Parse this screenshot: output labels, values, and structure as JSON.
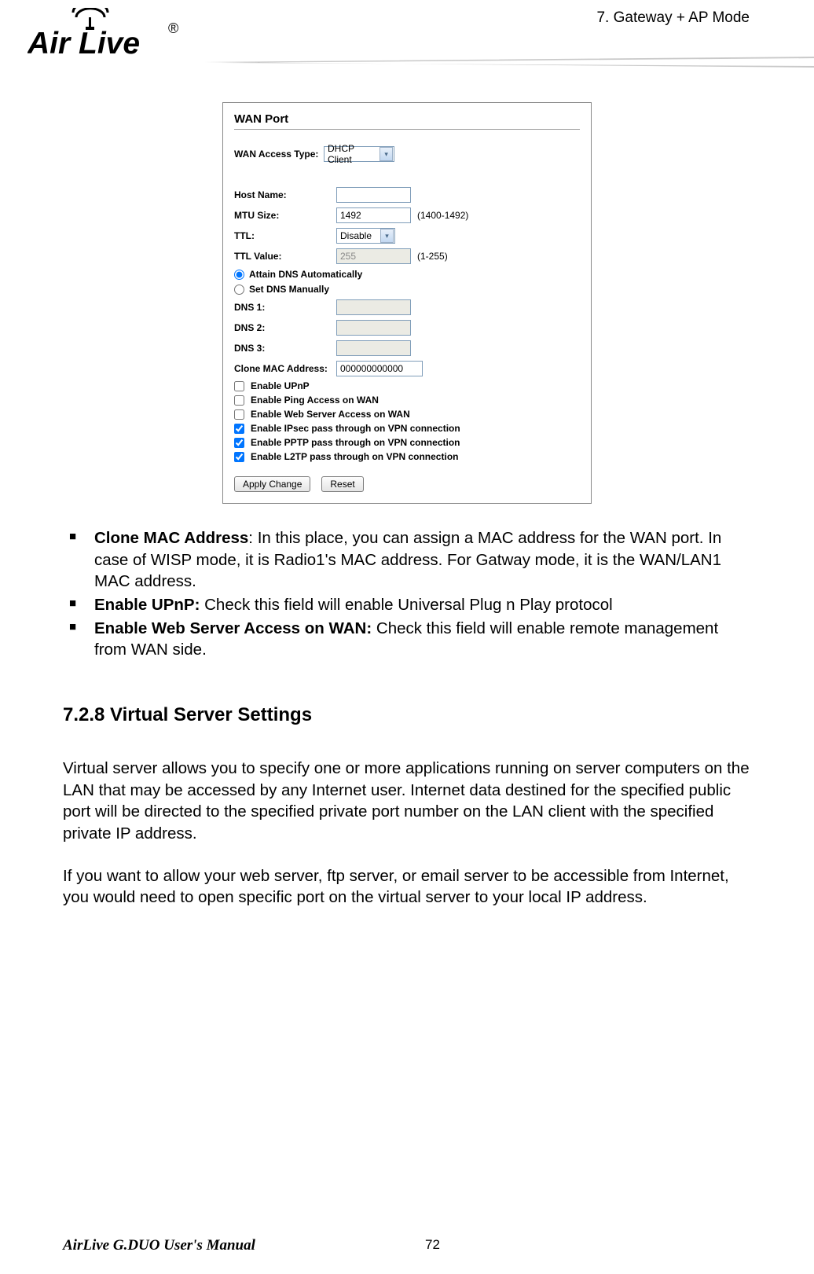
{
  "header": {
    "chapter": "7. Gateway + AP  Mode"
  },
  "panel": {
    "title": "WAN Port",
    "wan_access_type": {
      "label": "WAN Access Type:",
      "value": "DHCP Client"
    },
    "host_name": {
      "label": "Host Name:",
      "value": ""
    },
    "mtu": {
      "label": "MTU Size:",
      "value": "1492",
      "range": "(1400-1492)"
    },
    "ttl": {
      "label": "TTL:",
      "value": "Disable"
    },
    "ttl_value": {
      "label": "TTL Value:",
      "value": "255",
      "range": "(1-255)"
    },
    "dns_radio": {
      "auto": "Attain DNS Automatically",
      "manual": "Set DNS Manually"
    },
    "dns1": {
      "label": "DNS 1:",
      "value": ""
    },
    "dns2": {
      "label": "DNS 2:",
      "value": ""
    },
    "dns3": {
      "label": "DNS 3:",
      "value": ""
    },
    "clone_mac": {
      "label": "Clone MAC Address:",
      "value": "000000000000"
    },
    "checks": [
      {
        "label": "Enable UPnP",
        "checked": false
      },
      {
        "label": "Enable Ping Access on WAN",
        "checked": false
      },
      {
        "label": "Enable Web Server Access on WAN",
        "checked": false
      },
      {
        "label": "Enable IPsec pass through on VPN connection",
        "checked": true
      },
      {
        "label": "Enable PPTP pass through on VPN connection",
        "checked": true
      },
      {
        "label": "Enable L2TP pass through on VPN connection",
        "checked": true
      }
    ],
    "apply_btn": "Apply Change",
    "reset_btn": "Reset"
  },
  "bullets": [
    {
      "bold": "Clone MAC Address",
      "colon": ":   ",
      "text": "In this place, you can assign a MAC address for the WAN port.   In case of WISP mode, it is Radio1's MAC address.   For Gatway mode, it is the WAN/LAN1 MAC address."
    },
    {
      "bold": "Enable UPnP:",
      "colon": "   ",
      "text": "Check this field will enable Universal Plug n Play protocol"
    },
    {
      "bold": "Enable Web Server Access on WAN:",
      "colon": " ",
      "text": "Check this field will enable remote management from WAN side."
    }
  ],
  "section": {
    "heading": "7.2.8 Virtual Server Settings",
    "p1": "Virtual server allows you to specify one or more applications running on server computers on the LAN that may be accessed by any Internet user. Internet data destined for the specified public port will be directed to the specified private port number on the LAN client with the specified private IP address.",
    "p2": "If you want to allow your web server, ftp server, or email server to be accessible from Internet, you would need to open specific port on the virtual server to your local IP address."
  },
  "footer": {
    "manual": "AirLive G.DUO User's Manual",
    "page": "72"
  }
}
